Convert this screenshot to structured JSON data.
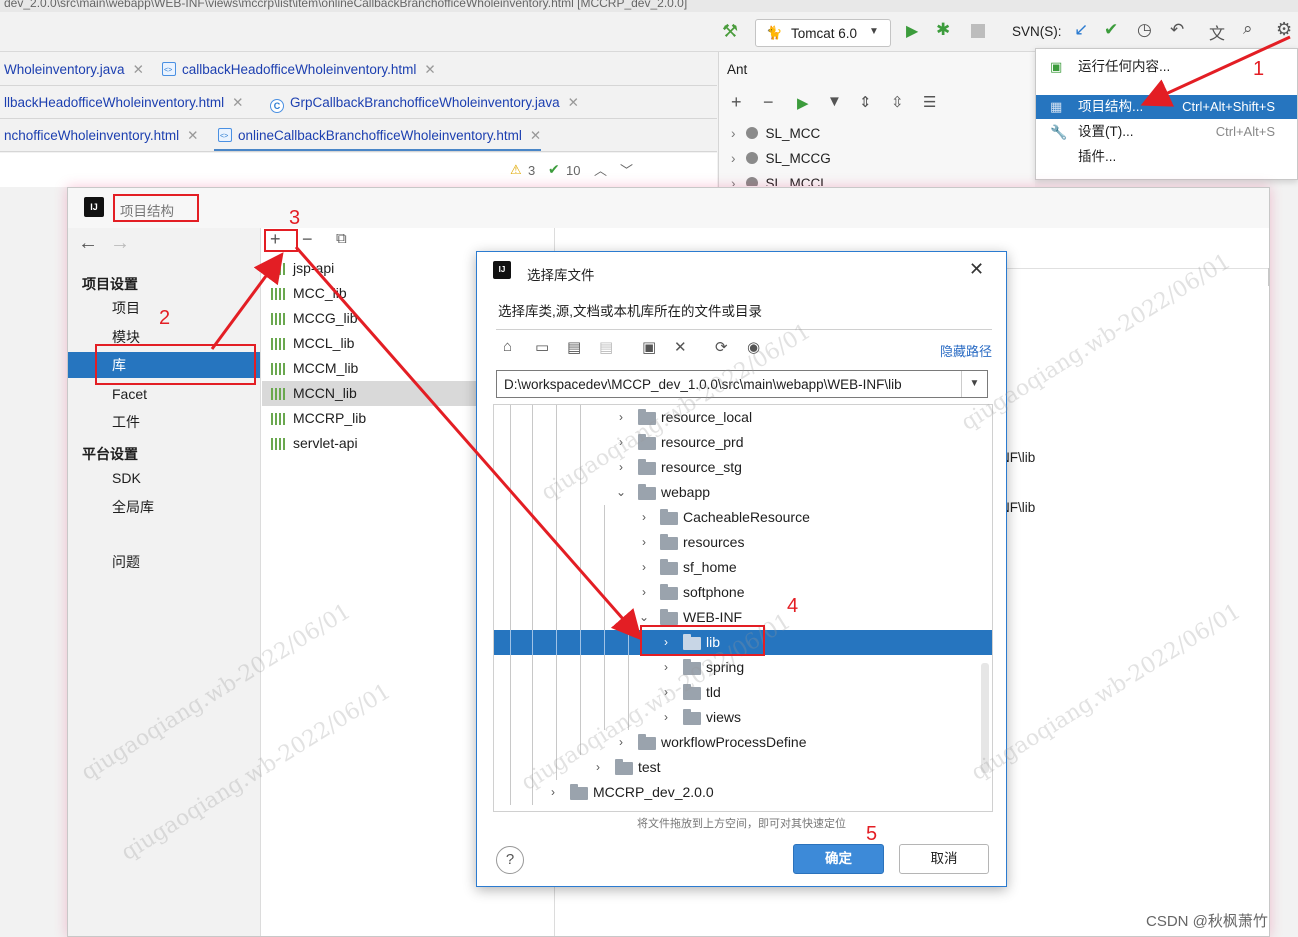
{
  "ide": {
    "title_fragment": "dev_2.0.0\\src\\main\\webapp\\WEB-INF\\views\\mccrp\\list\\item\\onlineCallbackBranchofficeWholeinventory.html [MCCRP_dev_2.0.0]",
    "run_config": "Tomcat 6.0",
    "svn_label": "SVN(S):",
    "tabs_row1": [
      "Wholeinventory.java",
      "callbackHeadofficeWholeinventory.html"
    ],
    "tabs_row2": [
      "llbackHeadofficeWholeinventory.html",
      "GrpCallbackBranchofficeWholeinventory.java"
    ],
    "tabs_row3": [
      "nchofficeWholeinventory.html",
      "onlineCallbackBranchofficeWholeinventory.html"
    ],
    "warnings": "3",
    "checks": "10",
    "ant_title": "Ant",
    "ant_items": [
      "SL_MCC",
      "SL_MCCG",
      "SL_MCCL"
    ]
  },
  "menu": {
    "items": [
      {
        "label": "运行任何内容...",
        "shortcut": ""
      },
      {
        "label": "项目结构...",
        "shortcut": "Ctrl+Alt+Shift+S"
      },
      {
        "label": "设置(T)...",
        "shortcut": "Ctrl+Alt+S"
      },
      {
        "label": "插件...",
        "shortcut": ""
      }
    ]
  },
  "project_structure": {
    "title": "项目结构",
    "section_project": "项目设置",
    "project_items": [
      "项目",
      "模块",
      "库",
      "Facet",
      "工件"
    ],
    "section_platform": "平台设置",
    "platform_items": [
      "SDK",
      "全局库"
    ],
    "problems": "问题",
    "libraries": [
      "jsp-api",
      "MCC_lib",
      "MCCG_lib",
      "MCCL_lib",
      "MCCM_lib",
      "MCCN_lib",
      "MCCRP_lib",
      "servlet-api"
    ],
    "right_fragments": [
      "NF\\lib",
      "NF\\lib"
    ]
  },
  "choose_lib": {
    "title": "选择库文件",
    "description": "选择库类,源,文档或本机库所在的文件或目录",
    "hide_path": "隐藏路径",
    "path": "D:\\workspacedev\\MCCP_dev_1.0.0\\src\\main\\webapp\\WEB-INF\\lib",
    "tree": [
      "resource_local",
      "resource_prd",
      "resource_stg",
      "webapp",
      "CacheableResource",
      "resources",
      "sf_home",
      "softphone",
      "WEB-INF",
      "lib",
      "spring",
      "tld",
      "views",
      "workflowProcessDefine",
      "test",
      "MCCRP_dev_2.0.0"
    ],
    "drop_hint": "将文件拖放到上方空间，即可对其快速定位",
    "ok": "确定",
    "cancel": "取消",
    "help": "?"
  },
  "annotations": [
    "1",
    "2",
    "3",
    "4",
    "5"
  ],
  "watermark": "qiugaoqiang.wb-2022/06/01",
  "csdn_credit": "CSDN @秋枫萧竹",
  "colors": {
    "selection": "#2675bf",
    "annotation": "#e31e24",
    "primary_button": "#3d8ad8"
  }
}
